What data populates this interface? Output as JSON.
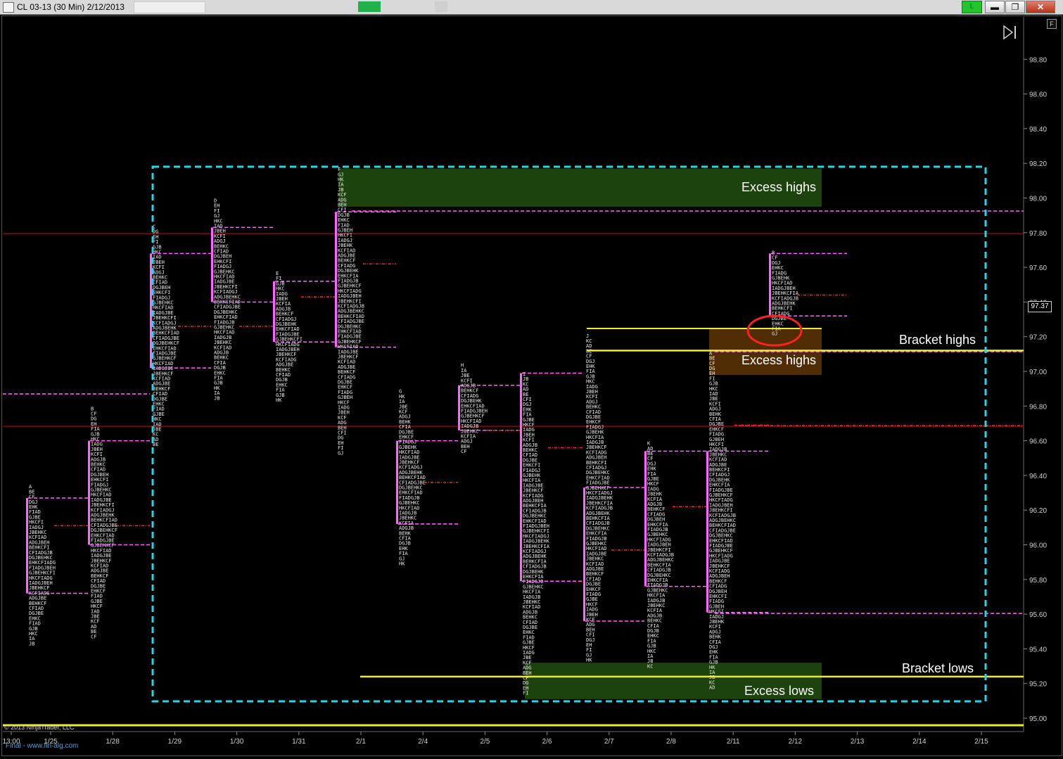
{
  "window": {
    "title": "CL 03-13 (30 Min)  2/12/2013",
    "live_badge": "L",
    "minimize_label": "▬",
    "restore_label": "❐",
    "close_label": "✕"
  },
  "toolbar": {
    "float_label": "F"
  },
  "colors": {
    "background": "#000000",
    "profile_bar": "#ff66ff",
    "value_line": "#ff66ff",
    "poc_line": "#ff2222",
    "annotation_box": "#22d8e8",
    "bracket_line": "#f0ea2a",
    "excess_green": "#1f4a0f",
    "excess_brown": "#5a3206",
    "circle": "#ff2020",
    "axis_text": "#d0d0d0"
  },
  "annotations": {
    "excess_highs_top": "Excess highs",
    "bracket_highs": "Bracket highs",
    "excess_highs_mid": "Excess highs",
    "bracket_lows": "Bracket lows",
    "excess_lows": "Excess lows"
  },
  "footer": {
    "copyright": "© 2013 NinjaTrader, LLC",
    "watermark": "Final - www.fin-alg.com"
  },
  "current_price": "97.37",
  "chart_data": {
    "type": "market-profile",
    "title": "CL 03-13 (30 Min)  2/12/2013",
    "x_ticks": [
      "13:00",
      "1/25",
      "1/28",
      "1/29",
      "1/30",
      "1/31",
      "2/1",
      "2/4",
      "2/5",
      "2/6",
      "2/7",
      "2/8",
      "2/11",
      "2/12",
      "2/13",
      "2/14",
      "2/15"
    ],
    "y_ticks": [
      "95.00",
      "95.20",
      "95.40",
      "95.60",
      "95.80",
      "96.00",
      "96.20",
      "96.40",
      "96.60",
      "96.80",
      "97.00",
      "97.20",
      "97.40",
      "97.60",
      "97.80",
      "98.00",
      "98.20",
      "98.40",
      "98.60",
      "98.80"
    ],
    "ylim": [
      94.95,
      98.85
    ],
    "current_price": 97.37,
    "sessions": [
      {
        "date": "1/24",
        "low": 95.4,
        "high": 96.35,
        "val": 95.72,
        "vah": 96.27,
        "poc": 96.11
      },
      {
        "date": "1/25",
        "low": 95.45,
        "high": 96.8,
        "val": 96.0,
        "vah": 96.6,
        "poc": 96.11
      },
      {
        "date": "1/28",
        "low": 96.55,
        "high": 97.85,
        "val": 97.02,
        "vah": 97.68,
        "poc": 97.26
      },
      {
        "date": "1/29",
        "low": 96.82,
        "high": 98.0,
        "val": 97.4,
        "vah": 97.83,
        "poc": 97.26
      },
      {
        "date": "1/30",
        "low": 96.82,
        "high": 97.58,
        "val": 97.17,
        "vah": 97.52,
        "poc": 97.43
      },
      {
        "date": "1/31",
        "low": 96.5,
        "high": 98.18,
        "val": 97.14,
        "vah": 97.92,
        "poc": 97.62
      },
      {
        "date": "2/1",
        "low": 95.85,
        "high": 96.9,
        "val": 96.12,
        "vah": 96.6,
        "poc": 96.36
      },
      {
        "date": "2/4",
        "low": 96.5,
        "high": 97.05,
        "val": 96.66,
        "vah": 96.92,
        "poc": 96.66
      },
      {
        "date": "2/5",
        "low": 95.12,
        "high": 97.0,
        "val": 95.79,
        "vah": 96.99,
        "poc": 96.56
      },
      {
        "date": "2/6",
        "low": 95.32,
        "high": 97.22,
        "val": 95.56,
        "vah": 96.33,
        "poc": 95.97
      },
      {
        "date": "2/7",
        "low": 95.28,
        "high": 96.6,
        "val": 95.76,
        "vah": 96.54,
        "poc": 96.22
      },
      {
        "date": "2/8",
        "low": 95.15,
        "high": 97.12,
        "val": 95.61,
        "vah": 96.54,
        "poc": 96.69
      },
      {
        "date": "2/11",
        "low": 97.2,
        "high": 97.7,
        "val": 97.32,
        "vah": 97.68,
        "poc": 97.44
      }
    ],
    "brackets": {
      "bracket_high": 97.12,
      "bracket_low": 95.24
    },
    "excess_zones": [
      {
        "label": "Excess highs",
        "from": 97.95,
        "to": 98.17
      },
      {
        "label": "Excess highs",
        "from": 96.98,
        "to": 97.25
      },
      {
        "label": "Excess lows",
        "from": 95.11,
        "to": 95.32
      }
    ]
  }
}
